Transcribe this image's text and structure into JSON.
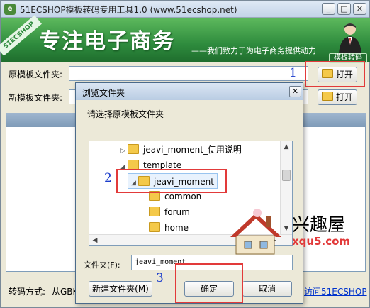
{
  "window": {
    "title": "51ECSHOP模板转码专用工具1.0  (www.51ecshop.net)",
    "controls": {
      "minimize": "_",
      "maximize": "□",
      "close": "✕"
    }
  },
  "banner": {
    "tag": "51ECSHOP",
    "slogan": "专注电子商务",
    "motto": "——我们致力于为电子商务提供动力",
    "badge": "模板转码"
  },
  "form": {
    "source_label": "原模板文件夹:",
    "new_label": "新模板文件夹:",
    "open_label": "打开"
  },
  "status": {
    "encoding_label": "转码方式:",
    "encoding_value": "从GBK",
    "link_text": "访问51ECSHOP"
  },
  "dialog": {
    "title": "浏览文件夹",
    "close": "✕",
    "instruction": "请选择原模板文件夹",
    "tree": [
      {
        "label": "jeavi_moment_使用说明",
        "expander": "▷"
      },
      {
        "label": "template",
        "expander": "◢"
      },
      {
        "label": "jeavi_moment",
        "expander": "◢"
      },
      {
        "label": "common",
        "expander": ""
      },
      {
        "label": "forum",
        "expander": ""
      },
      {
        "label": "home",
        "expander": ""
      }
    ],
    "folder_label": "文件夹(F):",
    "folder_value": "jeavi_moment",
    "new_folder_button": "新建文件夹(M)",
    "ok_button": "确定",
    "cancel_button": "取消"
  },
  "markers": [
    "1",
    "2",
    "3"
  ],
  "watermark": {
    "name": "兴趣屋",
    "site": "xqu5.com"
  },
  "colors": {
    "banner_green": "#2e8b3d",
    "highlight_red": "#e23a3a",
    "marker_blue": "#1a3ccc"
  }
}
